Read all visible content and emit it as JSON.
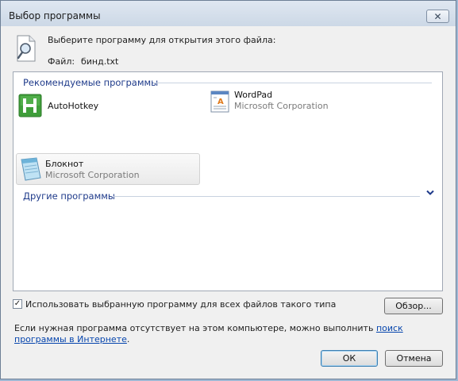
{
  "window": {
    "title": "Выбор программы",
    "close_glyph": "✕"
  },
  "header": {
    "prompt": "Выберите программу для открытия этого файла:",
    "file_label": "Файл:",
    "file_name": "бинд.txt",
    "icon": "document-search-icon"
  },
  "recommended": {
    "header": "Рекомендуемые программы",
    "items": [
      {
        "name": "AutoHotkey",
        "company": "",
        "icon": "autohotkey-icon"
      },
      {
        "name": "WordPad",
        "company": "Microsoft Corporation",
        "icon": "wordpad-icon"
      },
      {
        "name": "Блокнот",
        "company": "Microsoft Corporation",
        "icon": "notepad-icon",
        "selected": true
      }
    ]
  },
  "other": {
    "header": "Другие программы",
    "toggle_icon": "chevron-down-icon"
  },
  "options": {
    "always_use_label": "Использовать выбранную программу для всех файлов такого типа",
    "always_use_checked": true,
    "browse_button": "Обзор..."
  },
  "footer": {
    "help_prefix": "Если нужная программа отсутствует на этом компьютере, можно выполнить ",
    "help_link": "поиск программы в Интернете",
    "help_suffix": ".",
    "ok_button": "ОК",
    "cancel_button": "Отмена"
  },
  "colors": {
    "group_header": "#1e3a8a",
    "link": "#0645ad",
    "autohotkey_green": "#3f9e3a"
  }
}
